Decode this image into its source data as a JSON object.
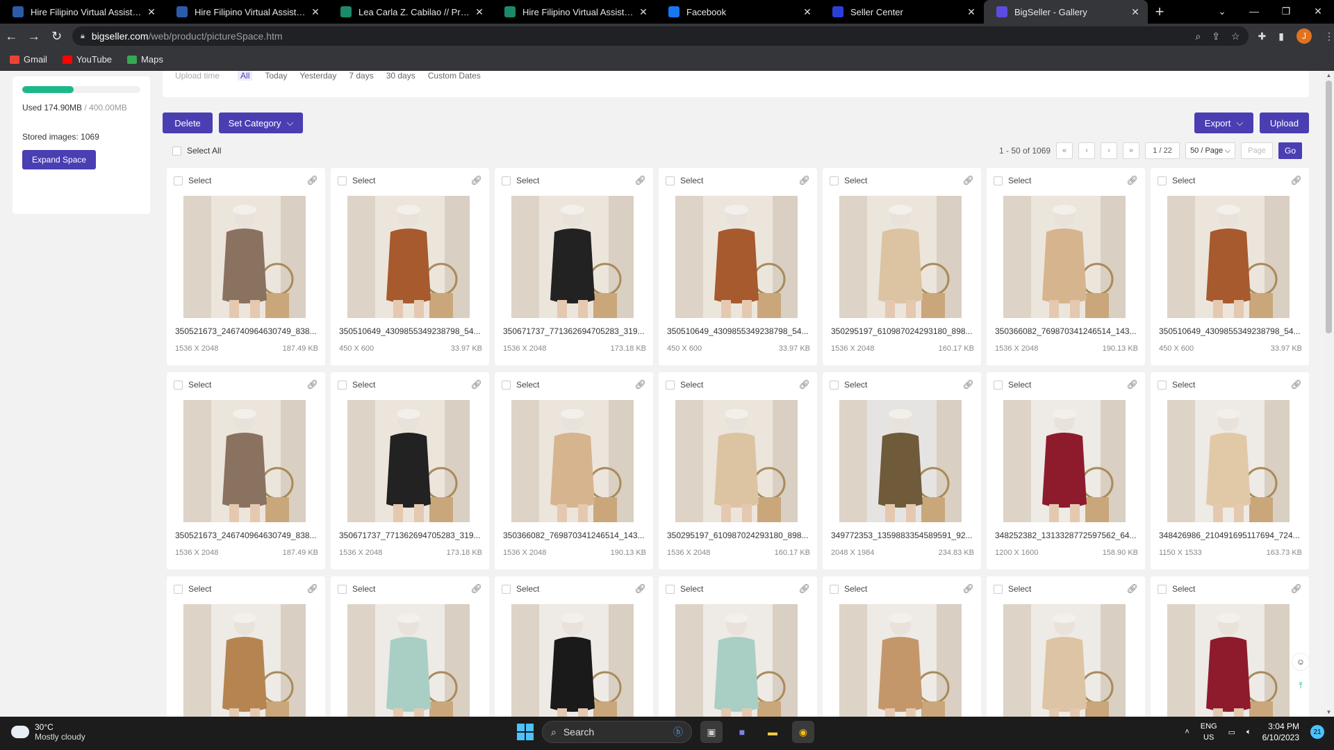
{
  "browser": {
    "tabs": [
      {
        "title": "Hire Filipino Virtual Assistants | F",
        "favicon": "onlinejobs-icon",
        "color": "#2a5caa"
      },
      {
        "title": "Hire Filipino Virtual Assistants | F",
        "favicon": "onlinejobs-icon",
        "color": "#2a5caa"
      },
      {
        "title": "Lea Carla Z. Cabilao // Professio",
        "favicon": "portfolio-icon",
        "color": "#1a8a6a"
      },
      {
        "title": "Hire Filipino Virtual Assistants | F",
        "favicon": "onlinejobs-icon",
        "color": "#1a8a6a"
      },
      {
        "title": "Facebook",
        "favicon": "facebook-icon",
        "color": "#1877f2"
      },
      {
        "title": "Seller Center",
        "favicon": "seller-center-icon",
        "color": "#2b3fd6"
      },
      {
        "title": "BigSeller - Gallery",
        "favicon": "bigseller-icon",
        "color": "#5b4de0"
      }
    ],
    "active_tab": 6,
    "url_host": "bigseller.com",
    "url_path": "/web/product/pictureSpace.htm",
    "bookmarks": [
      {
        "label": "Gmail",
        "color": "#ea4335"
      },
      {
        "label": "YouTube",
        "color": "#ff0000"
      },
      {
        "label": "Maps",
        "color": "#34a853"
      }
    ],
    "profile_initial": "J"
  },
  "filters": {
    "label": "Upload time",
    "options": [
      "All",
      "Today",
      "Yesterday",
      "7 days",
      "30 days",
      "Custom Dates"
    ],
    "selected": "All"
  },
  "storage": {
    "used_fraction": 0.437,
    "used_label": "Used 174.90MB",
    "total_label": " / 400.00MB",
    "stored_label": "Stored images: 1069",
    "expand_button": "Expand Space"
  },
  "actions": {
    "delete": "Delete",
    "set_category": "Set Category",
    "export": "Export",
    "upload": "Upload",
    "select_all": "Select All"
  },
  "pager": {
    "summary": "1 - 50 of 1069",
    "current": "1 / 22",
    "page_size": "50 / Page",
    "page_placeholder": "Page",
    "go": "Go"
  },
  "card_select_label": "Select",
  "images": [
    {
      "name": "350521673_246740964630749_838...",
      "dims": "1536 X 2048",
      "size": "187.49 KB",
      "tone": "#8a7260",
      "bg": "#ece5dc"
    },
    {
      "name": "350510649_4309855349238798_54...",
      "dims": "450 X 600",
      "size": "33.97 KB",
      "tone": "#a65a2e",
      "bg": "#ece5dc"
    },
    {
      "name": "350671737_771362694705283_319...",
      "dims": "1536 X 2048",
      "size": "173.18 KB",
      "tone": "#222222",
      "bg": "#ece5dc"
    },
    {
      "name": "350510649_4309855349238798_54...",
      "dims": "450 X 600",
      "size": "33.97 KB",
      "tone": "#a65a2e",
      "bg": "#ece5dc"
    },
    {
      "name": "350295197_610987024293180_898...",
      "dims": "1536 X 2048",
      "size": "160.17 KB",
      "tone": "#dcc3a2",
      "bg": "#ece5dc"
    },
    {
      "name": "350366082_769870341246514_143...",
      "dims": "1536 X 2048",
      "size": "190.13 KB",
      "tone": "#d6b48e",
      "bg": "#ece5dc"
    },
    {
      "name": "350510649_4309855349238798_54...",
      "dims": "450 X 600",
      "size": "33.97 KB",
      "tone": "#a65a2e",
      "bg": "#ece5dc"
    },
    {
      "name": "350521673_246740964630749_838...",
      "dims": "1536 X 2048",
      "size": "187.49 KB",
      "tone": "#8a7260",
      "bg": "#ece5dc"
    },
    {
      "name": "350671737_771362694705283_319...",
      "dims": "1536 X 2048",
      "size": "173.18 KB",
      "tone": "#222222",
      "bg": "#ece5dc"
    },
    {
      "name": "350366082_769870341246514_143...",
      "dims": "1536 X 2048",
      "size": "190.13 KB",
      "tone": "#d6b48e",
      "bg": "#ece5dc"
    },
    {
      "name": "350295197_610987024293180_898...",
      "dims": "1536 X 2048",
      "size": "160.17 KB",
      "tone": "#dcc3a2",
      "bg": "#ece5dc"
    },
    {
      "name": "349772353_1359883354589591_92...",
      "dims": "2048 X 1984",
      "size": "234.83 KB",
      "tone": "#6f5a3a",
      "bg": "#e6e4e2"
    },
    {
      "name": "348252382_1313328772597562_64...",
      "dims": "1200 X 1600",
      "size": "158.90 KB",
      "tone": "#8e1b2c",
      "bg": "#eeeae6"
    },
    {
      "name": "348426986_210491695117694_724...",
      "dims": "1150 X 1533",
      "size": "163.73 KB",
      "tone": "#e1c9a8",
      "bg": "#eeeae6"
    },
    {
      "name": "",
      "dims": "",
      "size": "",
      "tone": "#b68450",
      "bg": "#eeeae6"
    },
    {
      "name": "",
      "dims": "",
      "size": "",
      "tone": "#a9cfc5",
      "bg": "#eeeae6"
    },
    {
      "name": "",
      "dims": "",
      "size": "",
      "tone": "#1a1a1a",
      "bg": "#eeeae6"
    },
    {
      "name": "",
      "dims": "",
      "size": "",
      "tone": "#a9cfc5",
      "bg": "#eeeae6"
    },
    {
      "name": "",
      "dims": "",
      "size": "",
      "tone": "#c4976a",
      "bg": "#eeeae6"
    },
    {
      "name": "",
      "dims": "",
      "size": "",
      "tone": "#dcc4a4",
      "bg": "#eeeae6"
    },
    {
      "name": "",
      "dims": "",
      "size": "",
      "tone": "#8e1b2c",
      "bg": "#eeeae6"
    }
  ],
  "taskbar": {
    "temp": "30°C",
    "weather": "Mostly cloudy",
    "search": "Search",
    "lang1": "ENG",
    "lang2": "US",
    "time": "3:04 PM",
    "date": "6/10/2023",
    "notifications": "21"
  },
  "colors": {
    "accent": "#4a3eb3",
    "progress": "#1cb88a"
  }
}
